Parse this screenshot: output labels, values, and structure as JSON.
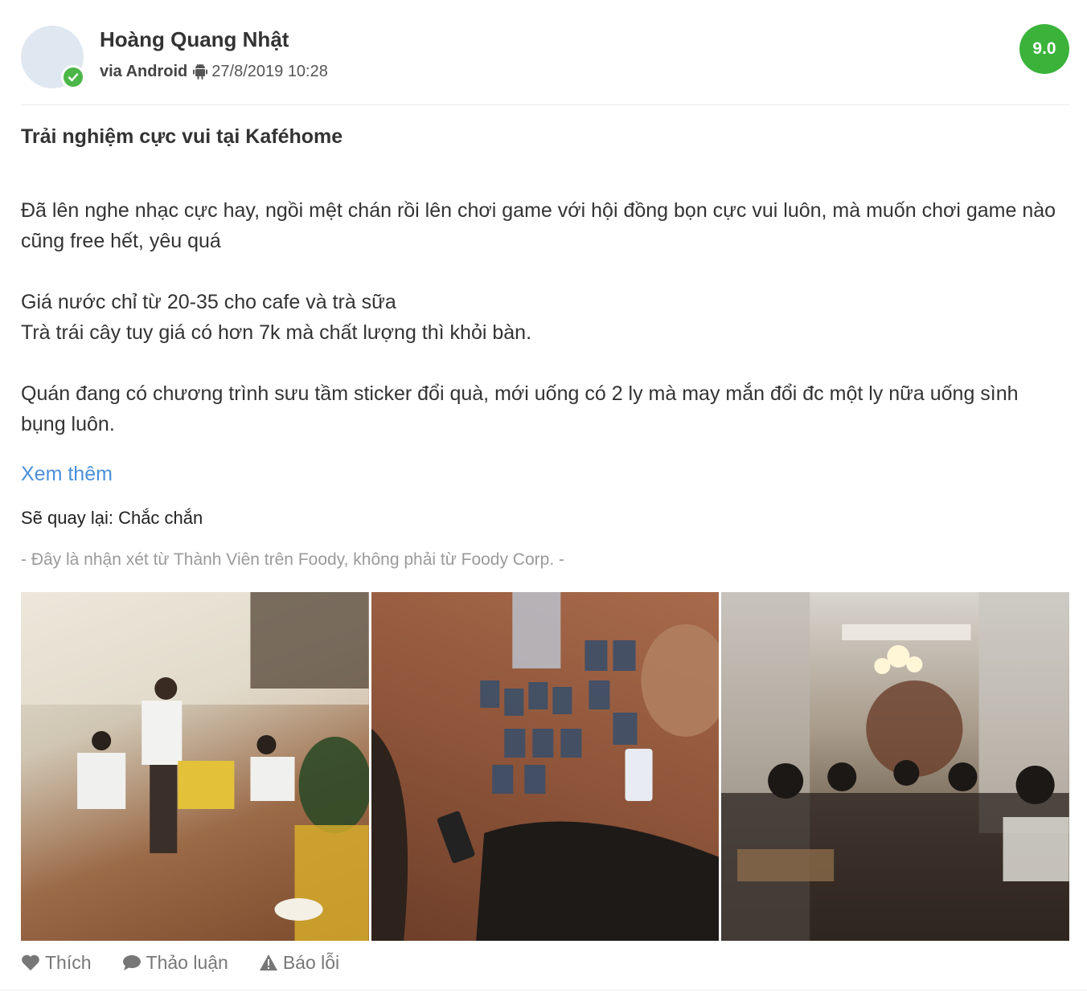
{
  "reviewer": {
    "name": "Hoàng Quang Nhật",
    "via": "via Android",
    "timestamp": "27/8/2019 10:28",
    "verified": true
  },
  "score": "9.0",
  "review": {
    "title": "Trải nghiệm cực vui tại Kaféhome",
    "paragraphs": [
      "Đã lên nghe nhạc cực hay, ngồi mệt chán rồi lên chơi game với hội đồng bọn cực vui luôn, mà muốn chơi game nào cũng free hết, yêu quá",
      "Giá nước chỉ từ 20-35 cho cafe và trà sữa",
      "Trà trái cây tuy giá có hơn 7k mà chất lượng thì khỏi bàn.",
      "Quán đang có chương trình sưu tầm sticker đổi quà, mới uống có 2 ly mà may mắn đổi đc một ly nữa uống sình bụng luôn."
    ],
    "see_more": "Xem thêm",
    "return_intent": "Sẽ quay lại: Chắc chắn",
    "disclaimer": "- Đây là nhận xét từ Thành Viên trên Foody, không phải từ Foody Corp. -"
  },
  "photos": [
    "photo-cafe-floor-seating",
    "photo-board-game-cards",
    "photo-cafe-interior-music"
  ],
  "actions": {
    "like": "Thích",
    "discuss": "Thảo luận",
    "report": "Báo lỗi"
  },
  "colors": {
    "score_badge": "#3bb33b",
    "verified_badge": "#4cb648",
    "link": "#4a90d9",
    "muted_text": "#9a9a9a"
  },
  "icons": [
    "verified-check-icon",
    "android-icon",
    "heart-icon",
    "comment-icon",
    "warning-icon"
  ]
}
